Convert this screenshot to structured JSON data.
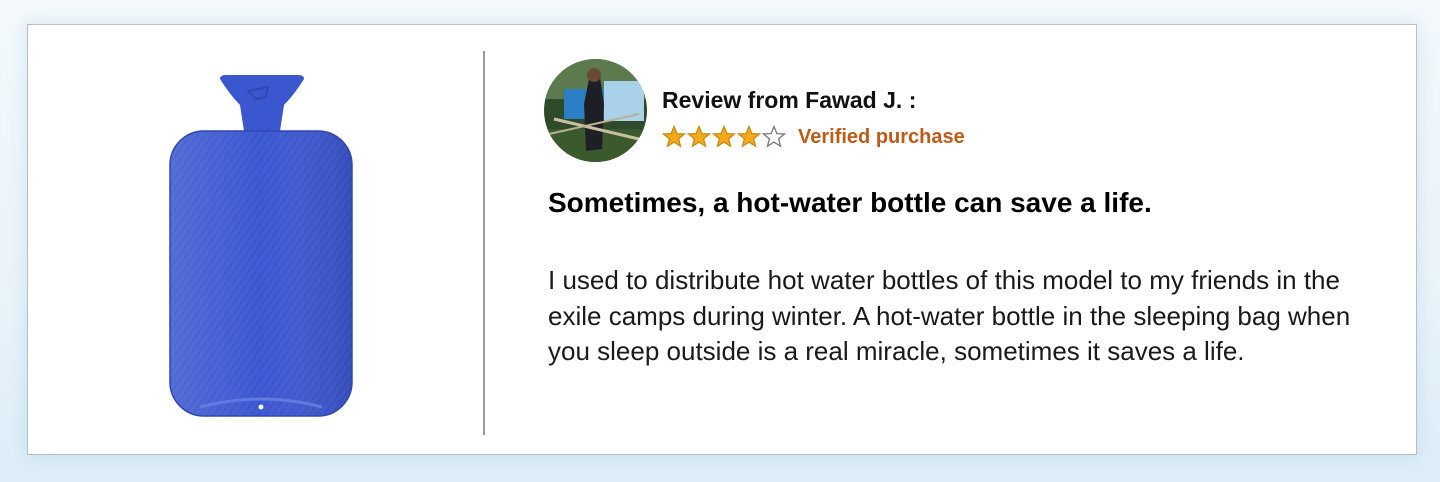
{
  "review": {
    "reviewer_label": "Review from Fawad J.  :",
    "rating": 4,
    "rating_max": 5,
    "verified_label": "Verified purchase",
    "headline": "Sometimes, a hot-water bottle can save a life.",
    "body": "I used to distribute hot water bottles of this model to my friends in the exile camps during winter. A hot-water bottle in the sleeping bag when you sleep outside is a real miracle, sometimes it saves a life."
  },
  "colors": {
    "star": "#f3a91c",
    "star_outline": "#c98a12",
    "verified": "#c05a17",
    "product": "#3d5bd6"
  }
}
